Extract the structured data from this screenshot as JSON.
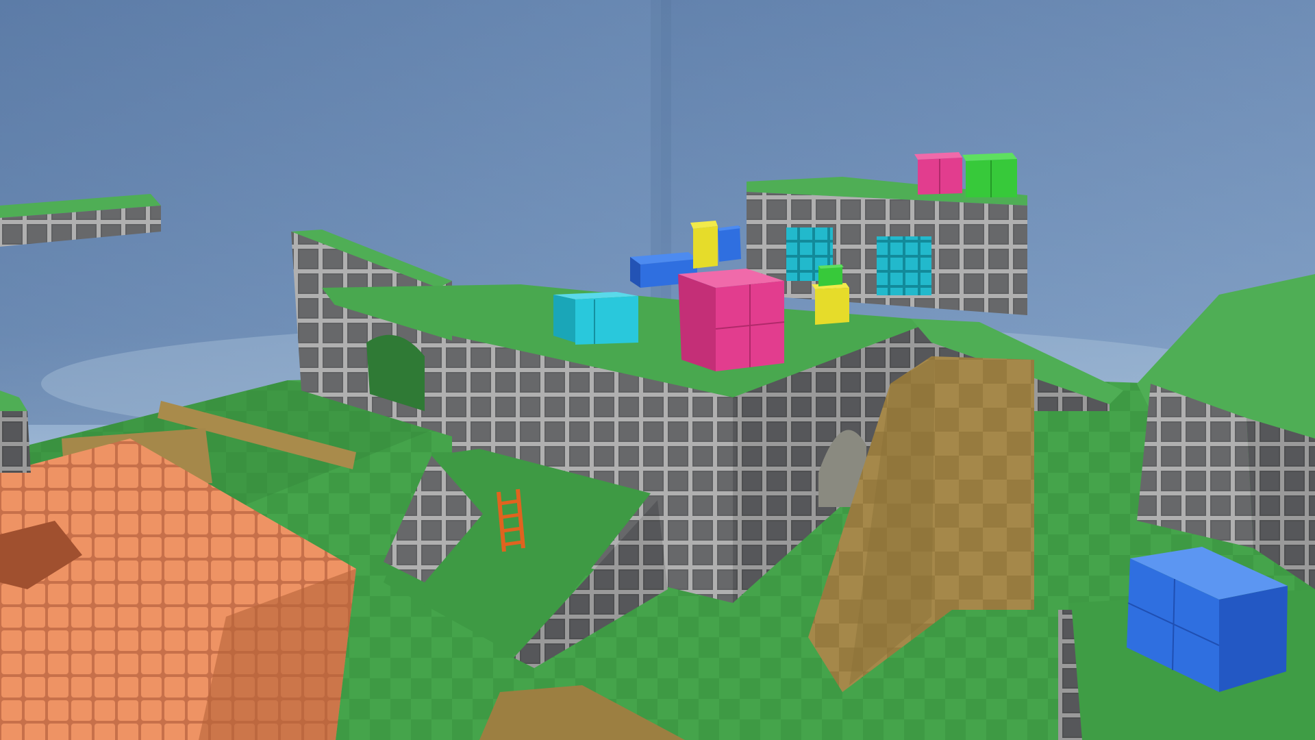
{
  "scene": {
    "name": "blockout-level-3d-view",
    "palette": {
      "sky_top": "#5f7fab",
      "sky_mid": "#7e9cc2",
      "sky_haze": "#a9c2dc",
      "back_wall_left": "#6d8cb4",
      "back_wall_right": "#7a98bf",
      "grass": "#3f9a45",
      "grass_light": "#55b45a",
      "grass_dark": "#2d7a33",
      "stone_face": "#6f7072",
      "stone_dark": "#4d4e50",
      "stone_grout": "#b4b4b4",
      "orange_block": "#e8895a",
      "orange_dark": "#b9643a",
      "wood": "#a78a45",
      "wood_dark": "#7a6330",
      "cube_magenta": "#e23d8e",
      "cube_green": "#37c93a",
      "cube_cyan": "#29c8dc",
      "cube_blue": "#2f6fe0",
      "cube_yellow": "#e6dc2a",
      "ladder": "#e0631f"
    },
    "objects": [
      {
        "kind": "floating-ledge",
        "material": "stone-grass"
      },
      {
        "kind": "central-fortress",
        "material": "stone-grass"
      },
      {
        "kind": "rear-tower",
        "material": "stone-grass"
      },
      {
        "kind": "teal-door-left",
        "material": "cyan"
      },
      {
        "kind": "teal-door-right",
        "material": "cyan"
      },
      {
        "kind": "right-cliff",
        "material": "stone-grass"
      },
      {
        "kind": "orange-block",
        "material": "orange"
      },
      {
        "kind": "wooden-planks",
        "material": "wood"
      },
      {
        "kind": "ramp-with-ladder",
        "material": "stone-grass"
      },
      {
        "kind": "magenta-cube-large",
        "material": "magenta"
      },
      {
        "kind": "cyan-crate",
        "material": "cyan"
      },
      {
        "kind": "blue-crate-top",
        "material": "blue"
      },
      {
        "kind": "yellow-cube-stack",
        "material": "yellow"
      },
      {
        "kind": "small-blue-cube",
        "material": "blue"
      },
      {
        "kind": "yellow-cube-small",
        "material": "yellow"
      },
      {
        "kind": "tiny-green-cube",
        "material": "green"
      },
      {
        "kind": "magenta-cube-tower",
        "material": "magenta"
      },
      {
        "kind": "green-cube-tower",
        "material": "green"
      },
      {
        "kind": "blue-cube-foreground",
        "material": "blue"
      }
    ]
  }
}
